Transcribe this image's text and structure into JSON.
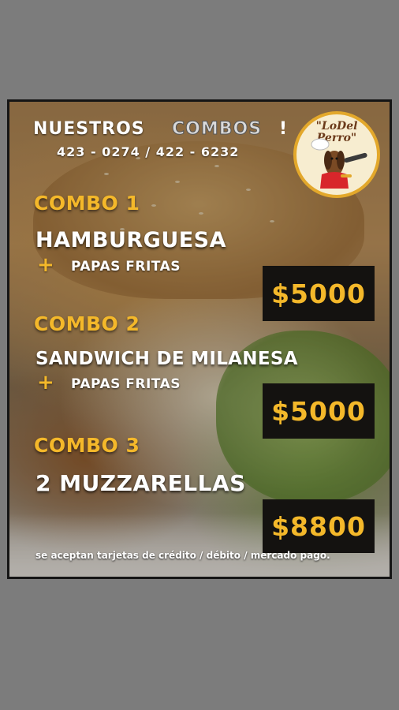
{
  "header": {
    "title_part1": "NUESTROS",
    "title_part2": "COMBOS",
    "title_excl": "!",
    "phones": "423 - 0274 / 422 - 6232"
  },
  "logo": {
    "line1": "\"LoDel",
    "line2": "Perro\""
  },
  "combos": [
    {
      "label": "COMBO 1",
      "item": "HAMBURGUESA",
      "extra_symbol": "+",
      "extra": "PAPAS FRITAS",
      "price": "$5000"
    },
    {
      "label": "COMBO 2",
      "item": "SANDWICH DE MILANESA",
      "extra_symbol": "+",
      "extra": "PAPAS FRITAS",
      "price": "$5000"
    },
    {
      "label": "COMBO 3",
      "item": "2 MUZZARELLAS",
      "price": "$8800"
    }
  ],
  "footer": "se aceptan tarjetas de crédito / débito / mercado pago.",
  "colors": {
    "accent": "#f4b82a",
    "price_bg": "#141210",
    "background": "#7c7c7c"
  }
}
